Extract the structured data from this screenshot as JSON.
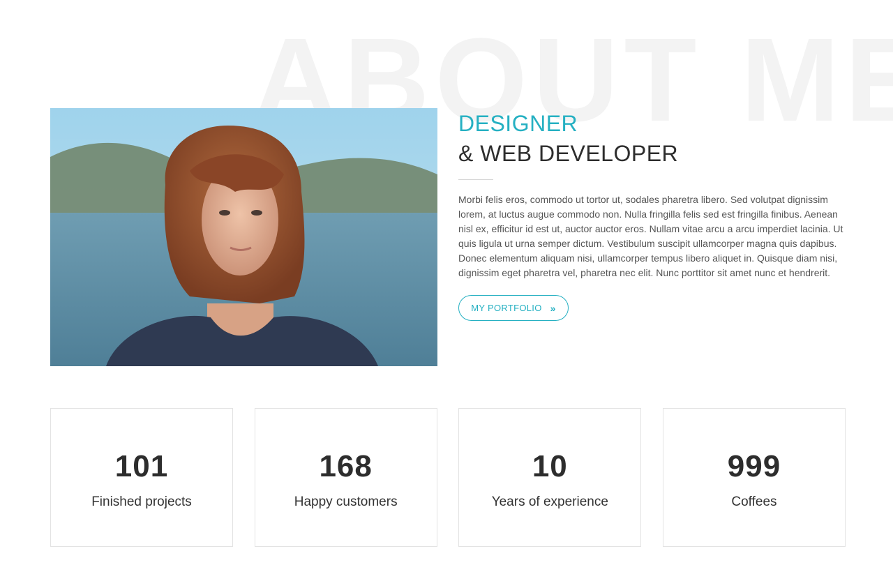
{
  "section": {
    "background_title": "ABOUT ME"
  },
  "about": {
    "role_primary": "DESIGNER",
    "role_secondary": "& WEB DEVELOPER",
    "bio": "Morbi felis eros, commodo ut tortor ut, sodales pharetra libero. Sed volutpat dignissim lorem, at luctus augue commodo non. Nulla fringilla felis sed est fringilla finibus. Aenean nisl ex, efficitur id est ut, auctor auctor eros. Nullam vitae arcu a arcu imperdiet lacinia. Ut quis ligula ut urna semper dictum. Vestibulum suscipit ullamcorper magna quis dapibus. Donec elementum aliquam nisi, ullamcorper tempus libero aliquet in. Quisque diam nisi, dignissim eget pharetra vel, pharetra nec elit. Nunc porttitor sit amet nunc et hendrerit.",
    "button_label": "MY PORTFOLIO",
    "button_icon": "double-chevron-right-icon",
    "button_icon_glyph": "»"
  },
  "stats": [
    {
      "number": "101",
      "label": "Finished projects"
    },
    {
      "number": "168",
      "label": "Happy customers"
    },
    {
      "number": "10",
      "label": "Years of experience"
    },
    {
      "number": "999",
      "label": "Coffees"
    }
  ],
  "colors": {
    "accent": "#25b0c2",
    "heading": "#2d2d2d",
    "body_text": "#555555",
    "background_title": "#f3f3f3",
    "card_border": "#e3e3e3"
  }
}
